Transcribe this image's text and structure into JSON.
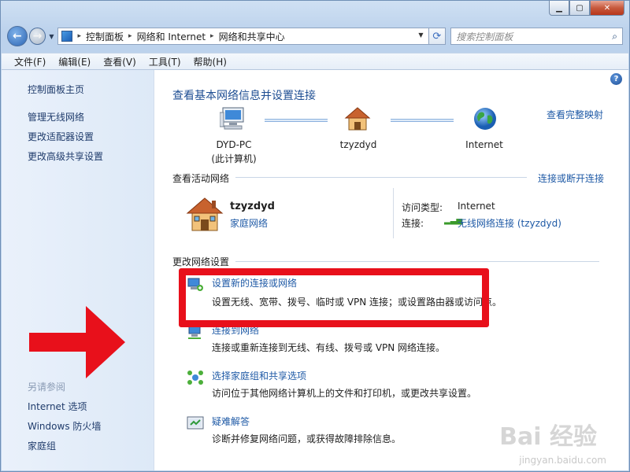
{
  "window": {
    "min_label": "▁",
    "max_label": "▢",
    "close_label": "✕"
  },
  "address": {
    "crumbs": [
      "控制面板",
      "网络和 Internet",
      "网络和共享中心"
    ],
    "search_placeholder": "搜索控制面板"
  },
  "menu": [
    "文件(F)",
    "编辑(E)",
    "查看(V)",
    "工具(T)",
    "帮助(H)"
  ],
  "sidebar": {
    "links": [
      "控制面板主页",
      "管理无线网络",
      "更改适配器设置",
      "更改高级共享设置"
    ],
    "see_also_label": "另请参阅",
    "see_also": [
      "Internet 选项",
      "Windows 防火墙",
      "家庭组"
    ]
  },
  "main": {
    "title": "查看基本网络信息并设置连接",
    "full_map_link": "查看完整映射",
    "nodes": [
      {
        "line1": "DYD-PC",
        "line2": "(此计算机)"
      },
      {
        "line1": "tzyzdyd",
        "line2": ""
      },
      {
        "line1": "Internet",
        "line2": ""
      }
    ],
    "active_label": "查看活动网络",
    "connect_link": "连接或断开连接",
    "active_network": {
      "name": "tzyzdyd",
      "type": "家庭网络",
      "access_type_label": "访问类型:",
      "access_type_value": "Internet",
      "connection_label": "连接:",
      "connection_value": "无线网络连接 (tzyzdyd)"
    },
    "change_label": "更改网络设置",
    "tasks": [
      {
        "title": "设置新的连接或网络",
        "desc": "设置无线、宽带、拨号、临时或 VPN 连接；或设置路由器或访问点。"
      },
      {
        "title": "连接到网络",
        "desc": "连接或重新连接到无线、有线、拨号或 VPN 网络连接。"
      },
      {
        "title": "选择家庭组和共享选项",
        "desc": "访问位于其他网络计算机上的文件和打印机，或更改共享设置。"
      },
      {
        "title": "疑难解答",
        "desc": "诊断并修复网络问题，或获得故障排除信息。"
      }
    ]
  },
  "watermark": {
    "logo": "Bai 经验",
    "url": "jingyan.baidu.com"
  },
  "colors": {
    "link": "#1f5aa6",
    "highlight": "#e8101b",
    "sidebar_bg": "#e4eef9"
  }
}
